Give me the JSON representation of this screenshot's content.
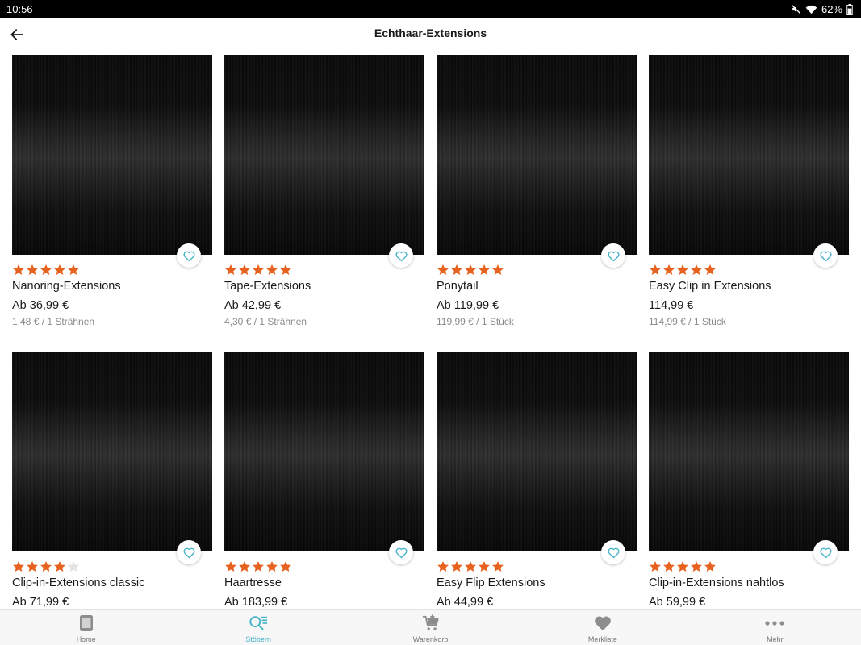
{
  "status": {
    "time": "10:56",
    "battery": "62%"
  },
  "header": {
    "title": "Echthaar-Extensions"
  },
  "colors": {
    "star": "#e7621f",
    "star_empty": "#e3e3e3",
    "accent": "#46b3c9",
    "nav_icon": "#8d8d8d"
  },
  "products": [
    {
      "name": "Nanoring-Extensions",
      "price": "Ab 36,99 €",
      "unit_price": "1,48 € / 1 Strähnen",
      "rating": 5
    },
    {
      "name": "Tape-Extensions",
      "price": "Ab 42,99 €",
      "unit_price": "4,30 € / 1 Strähnen",
      "rating": 5
    },
    {
      "name": "Ponytail",
      "price": "Ab 119,99 €",
      "unit_price": "119,99 € / 1 Stück",
      "rating": 5
    },
    {
      "name": "Easy Clip in Extensions",
      "price": "114,99 €",
      "unit_price": "114,99 € / 1 Stück",
      "rating": 5
    },
    {
      "name": "Clip-in-Extensions classic",
      "price": "Ab 71,99 €",
      "unit_price": "",
      "rating": 4
    },
    {
      "name": "Haartresse",
      "price": "Ab 183,99 €",
      "unit_price": "",
      "rating": 5
    },
    {
      "name": "Easy Flip Extensions",
      "price": "Ab 44,99 €",
      "unit_price": "",
      "rating": 5
    },
    {
      "name": "Clip-in-Extensions nahtlos",
      "price": "Ab 59,99 €",
      "unit_price": "",
      "rating": 5
    }
  ],
  "nav": [
    {
      "label": "Home",
      "icon": "tablet-icon",
      "active": false
    },
    {
      "label": "Stöbern",
      "icon": "search-list-icon",
      "active": true
    },
    {
      "label": "Warenkorb",
      "icon": "cart-icon",
      "active": false
    },
    {
      "label": "Merkliste",
      "icon": "heart-icon",
      "active": false
    },
    {
      "label": "Mehr",
      "icon": "more-icon",
      "active": false
    }
  ]
}
